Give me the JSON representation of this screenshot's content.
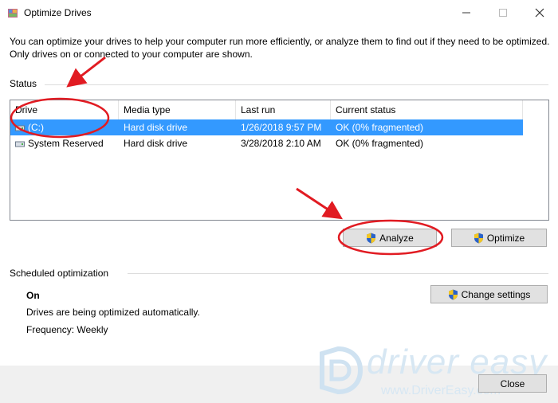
{
  "window": {
    "title": "Optimize Drives"
  },
  "description": "You can optimize your drives to help your computer run more efficiently, or analyze them to find out if they need to be optimized. Only drives on or connected to your computer are shown.",
  "status": {
    "label": "Status",
    "columns": [
      "Drive",
      "Media type",
      "Last run",
      "Current status"
    ],
    "rows": [
      {
        "drive": "(C:)",
        "media": "Hard disk drive",
        "last_run": "1/26/2018 9:57 PM",
        "status": "OK (0% fragmented)",
        "selected": true
      },
      {
        "drive": "System Reserved",
        "media": "Hard disk drive",
        "last_run": "3/28/2018 2:10 AM",
        "status": "OK (0% fragmented)",
        "selected": false
      }
    ]
  },
  "buttons": {
    "analyze": "Analyze",
    "optimize": "Optimize",
    "change_settings": "Change settings",
    "close": "Close"
  },
  "scheduled": {
    "label": "Scheduled optimization",
    "state": "On",
    "message": "Drives are being optimized automatically.",
    "frequency": "Frequency: Weekly"
  },
  "watermark": {
    "brand": "driver easy",
    "url": "www.DriverEasy.com"
  },
  "colors": {
    "selection": "#3399ff",
    "annotation": "#e11b22",
    "shield_blue": "#2a62c9",
    "shield_yellow": "#f3c623"
  },
  "icons": {
    "app": "defrag-icon",
    "shield": "uac-shield-icon",
    "drive": "hard-drive-icon"
  }
}
